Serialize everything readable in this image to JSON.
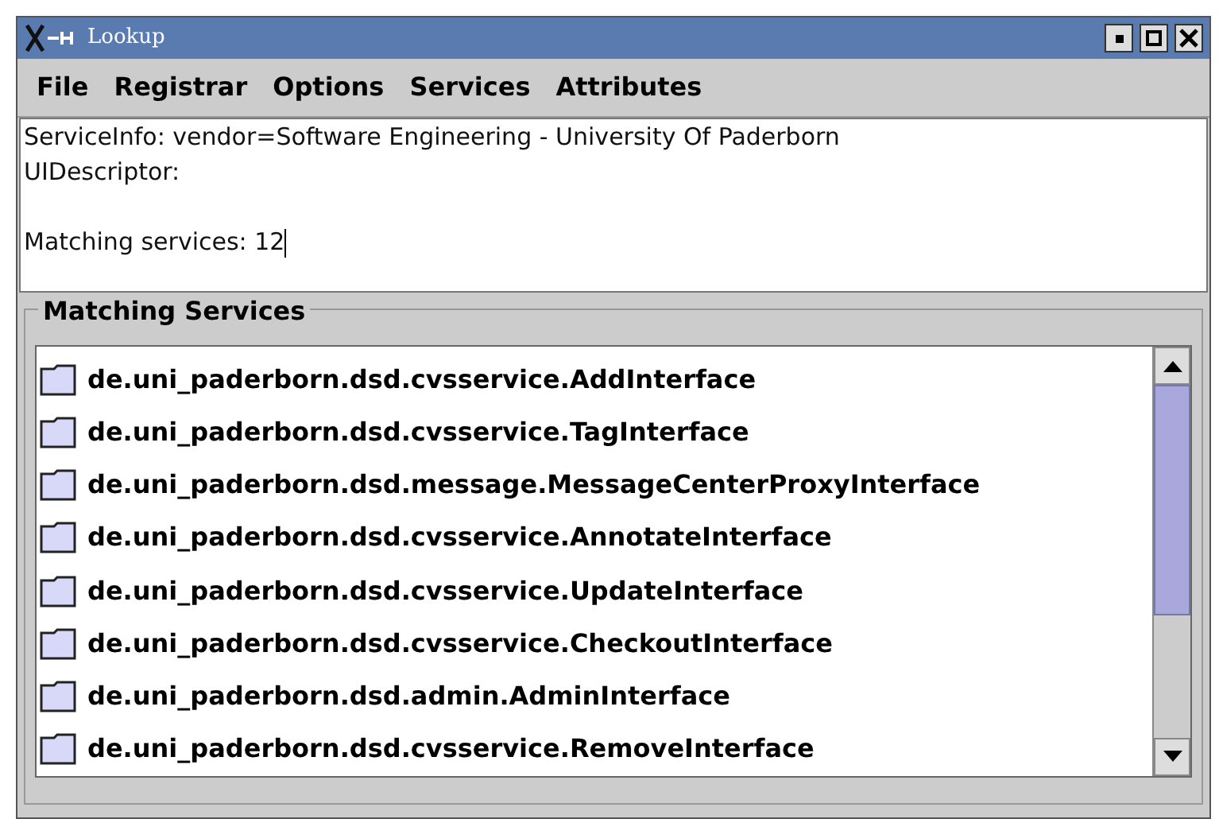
{
  "window": {
    "title": "Lookup"
  },
  "menu": [
    "File",
    "Registrar",
    "Options",
    "Services",
    "Attributes"
  ],
  "info": {
    "service_info": "ServiceInfo: vendor=Software Engineering - University Of Paderborn",
    "ui_descriptor": "UIDescriptor:",
    "matching_count": "Matching services: 12"
  },
  "group": {
    "title": "Matching Services"
  },
  "services": [
    {
      "label": "de.uni_paderborn.dsd.cvsservice.AddInterface"
    },
    {
      "label": "de.uni_paderborn.dsd.cvsservice.TagInterface"
    },
    {
      "label": "de.uni_paderborn.dsd.message.MessageCenterProxyInterface"
    },
    {
      "label": "de.uni_paderborn.dsd.cvsservice.AnnotateInterface"
    },
    {
      "label": "de.uni_paderborn.dsd.cvsservice.UpdateInterface"
    },
    {
      "label": "de.uni_paderborn.dsd.cvsservice.CheckoutInterface"
    },
    {
      "label": "de.uni_paderborn.dsd.admin.AdminInterface"
    },
    {
      "label": "de.uni_paderborn.dsd.cvsservice.RemoveInterface"
    }
  ]
}
